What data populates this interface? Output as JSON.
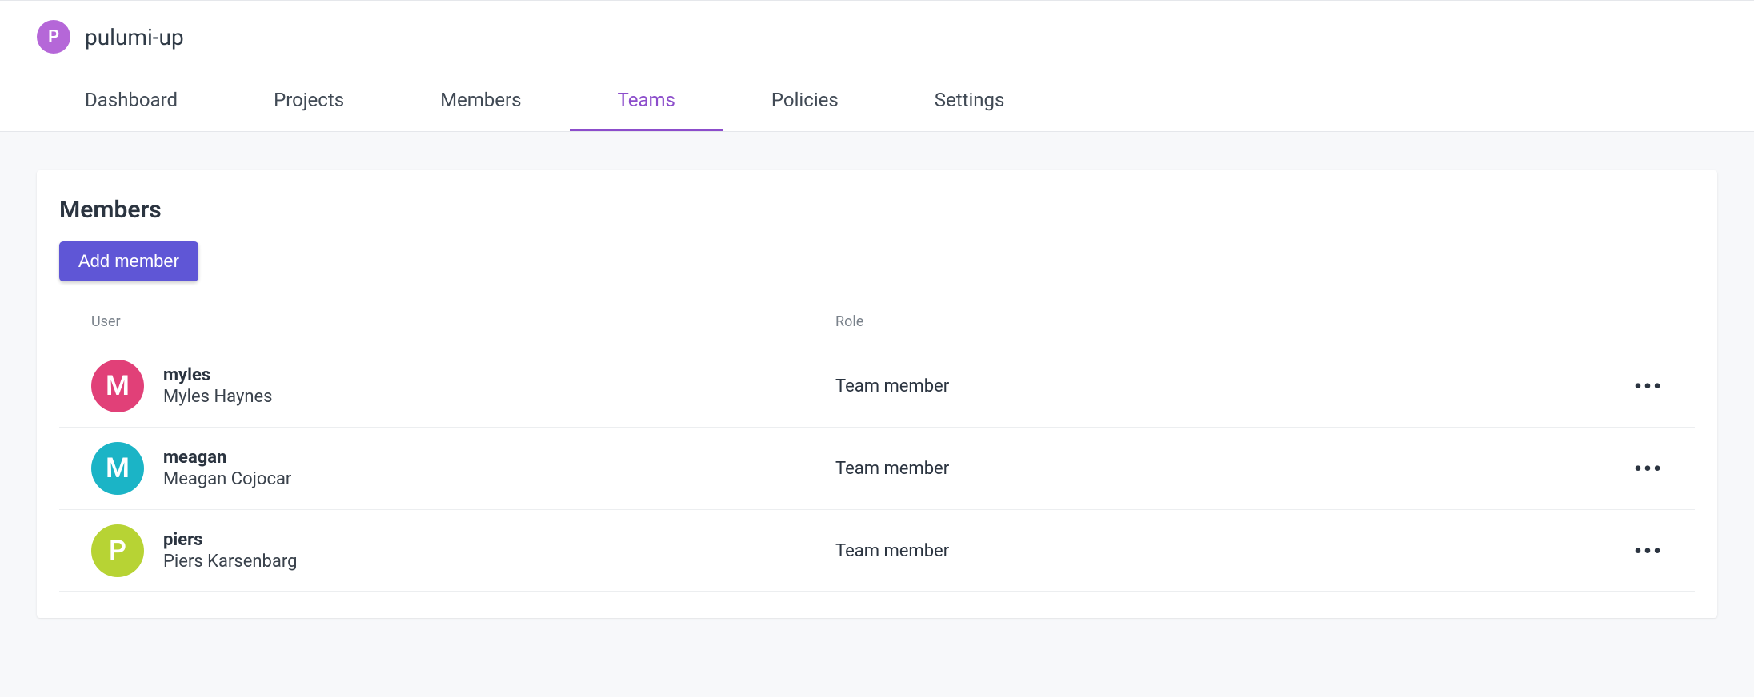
{
  "org": {
    "avatar_letter": "P",
    "name": "pulumi-up"
  },
  "tabs": [
    {
      "id": "dashboard",
      "label": "Dashboard",
      "active": false
    },
    {
      "id": "projects",
      "label": "Projects",
      "active": false
    },
    {
      "id": "members",
      "label": "Members",
      "active": false
    },
    {
      "id": "teams",
      "label": "Teams",
      "active": true
    },
    {
      "id": "policies",
      "label": "Policies",
      "active": false
    },
    {
      "id": "settings",
      "label": "Settings",
      "active": false
    }
  ],
  "section": {
    "title": "Members",
    "add_button_label": "Add member"
  },
  "columns": {
    "user": "User",
    "role": "Role"
  },
  "members": [
    {
      "avatar_letter": "M",
      "avatar_color": "#e14078",
      "username": "myles",
      "fullname": "Myles Haynes",
      "role": "Team member"
    },
    {
      "avatar_letter": "M",
      "avatar_color": "#1bb4c6",
      "username": "meagan",
      "fullname": "Meagan Cojocar",
      "role": "Team member"
    },
    {
      "avatar_letter": "P",
      "avatar_color": "#b7d334",
      "username": "piers",
      "fullname": "Piers Karsenbarg",
      "role": "Team member"
    }
  ]
}
